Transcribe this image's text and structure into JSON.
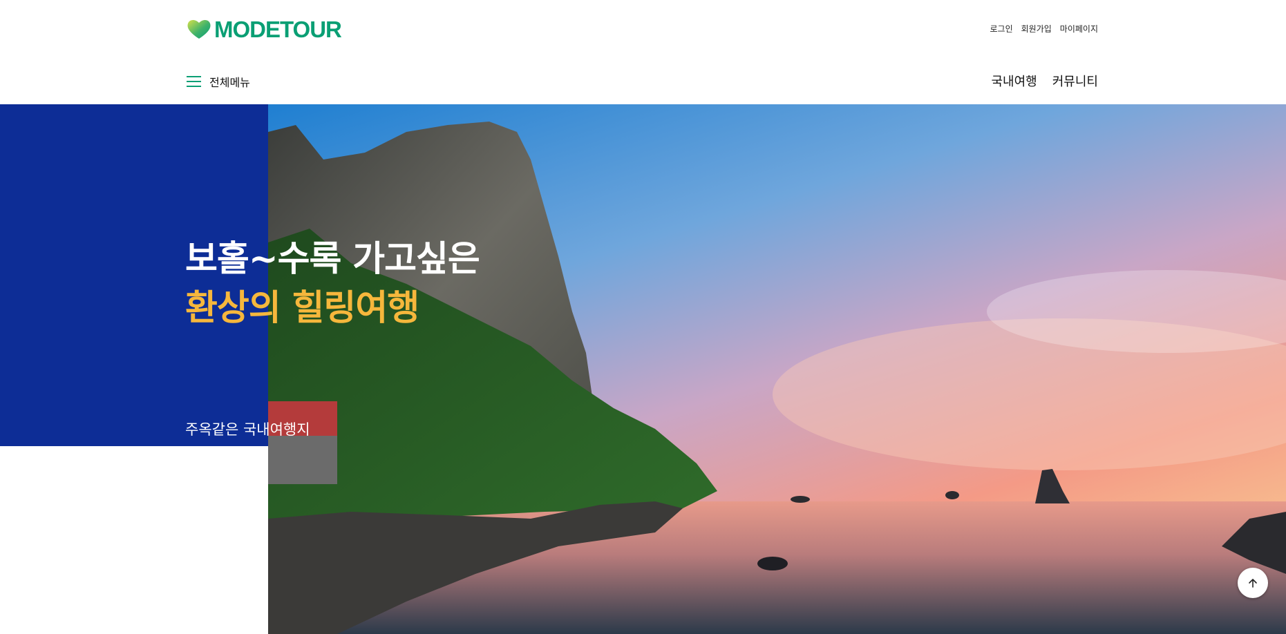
{
  "header": {
    "logo_text": "MODETOUR",
    "util_links": [
      "로그인",
      "회원가입",
      "마이페이지"
    ],
    "all_menu_label": "전체메뉴",
    "gnb": [
      "국내여행",
      "커뮤니티"
    ]
  },
  "hero": {
    "headline_line1": "보홀~수록 가고싶은",
    "headline_line2": "환상의 힐링여행",
    "subline": "주옥같은 국내여행지"
  },
  "colors": {
    "brand_green": "#0a9f74",
    "hero_blue": "#0d2d96",
    "accent_yellow": "#f6b73c"
  },
  "icons": {
    "menu": "hamburger-icon",
    "scroll_top": "arrow-up-icon",
    "logo": "heart-logo-icon"
  }
}
